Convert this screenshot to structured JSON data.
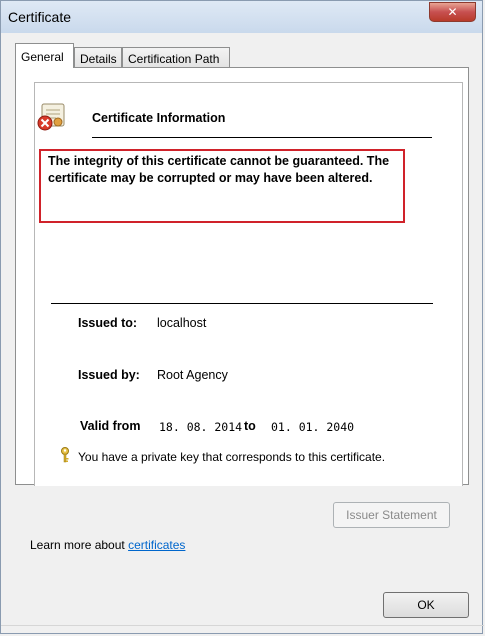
{
  "window": {
    "title": "Certificate",
    "close_symbol": "✕"
  },
  "tabs": [
    {
      "label": "General",
      "active": true
    },
    {
      "label": "Details",
      "active": false
    },
    {
      "label": "Certification Path",
      "active": false
    }
  ],
  "general": {
    "info_heading": "Certificate Information",
    "warning_text": "The integrity of this certificate cannot be guaranteed. The certificate may be corrupted or may have been altered.",
    "issued_to_label": "Issued to:",
    "issued_to_value": "localhost",
    "issued_by_label": "Issued by:",
    "issued_by_value": "Root Agency",
    "valid_from_label": "Valid from",
    "valid_from_value": "18. 08. 2014",
    "valid_to_label": "to",
    "valid_to_value": "01. 01. 2040",
    "private_key_text": "You have a private key that corresponds to this certificate.",
    "issuer_statement_button": "Issuer Statement"
  },
  "footer": {
    "learn_more_text": "Learn more about",
    "learn_more_link": "certificates",
    "ok_button": "OK"
  },
  "colors": {
    "warning_border": "#d0222a",
    "link": "#0066cc"
  }
}
